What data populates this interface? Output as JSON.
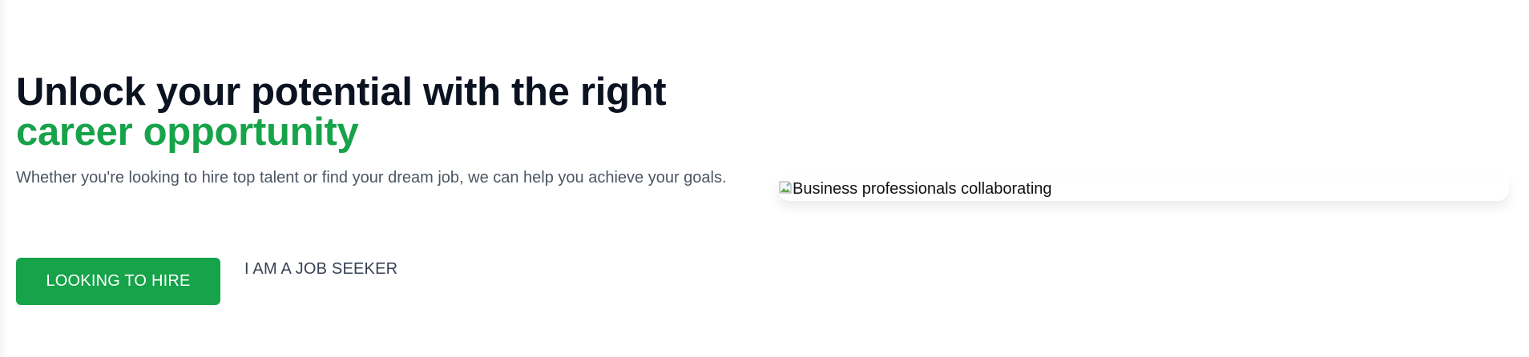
{
  "hero": {
    "headline_line1": "Unlock your potential with the right",
    "headline_line2": "career opportunity",
    "subtitle": "Whether you're looking to hire top talent or find your dream job, we can help you achieve your goals.",
    "primary_button_label": "LOOKING TO HIRE",
    "secondary_button_label": "I AM A JOB SEEKER"
  },
  "image": {
    "alt_text": "Business professionals collaborating",
    "icon": "broken-image-icon"
  },
  "colors": {
    "accent": "#17a34a",
    "headline": "#0b1220",
    "body_text": "#4b5563"
  }
}
